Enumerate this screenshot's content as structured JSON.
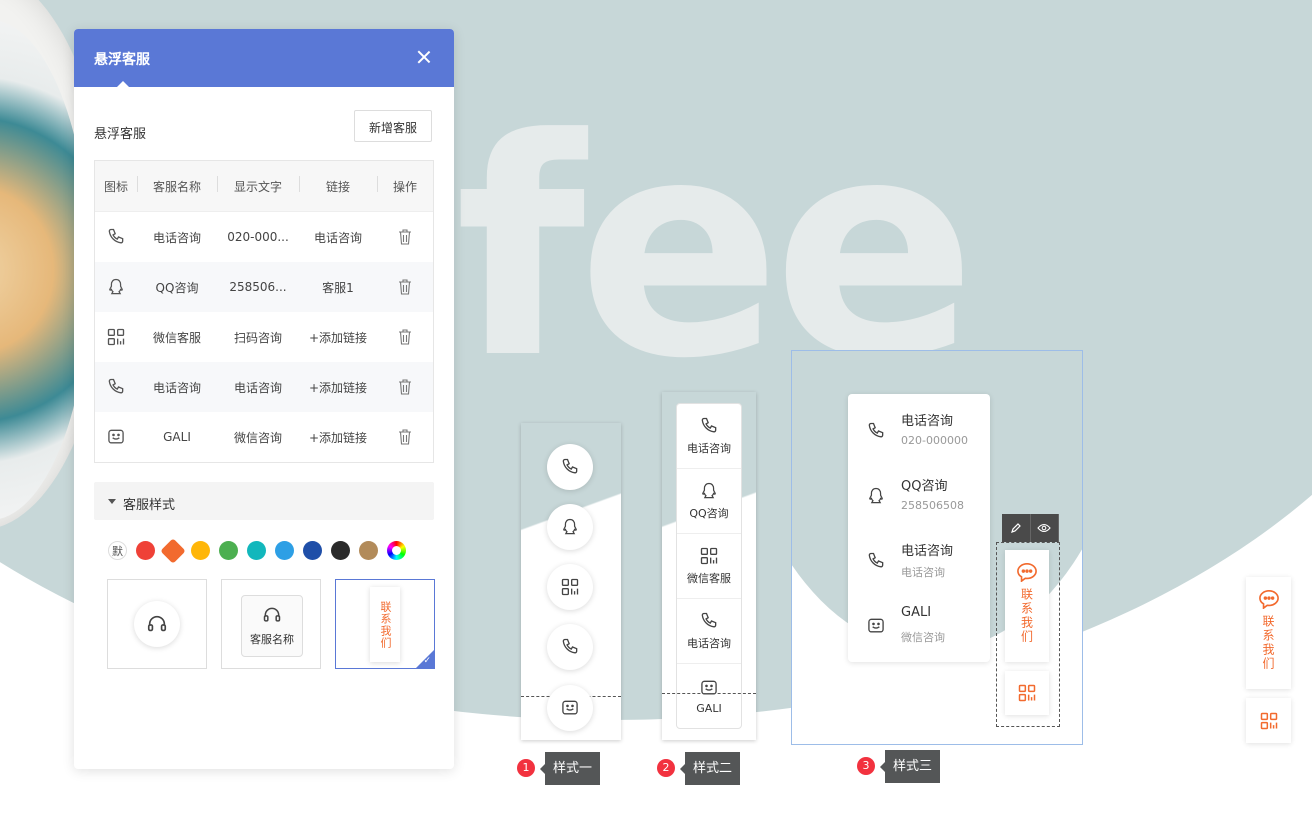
{
  "panel": {
    "title": "悬浮客服",
    "section_label": "悬浮客服",
    "add_button": "新增客服",
    "columns": [
      "图标",
      "客服名称",
      "显示文字",
      "链接",
      "操作"
    ],
    "rows": [
      {
        "icon": "phone-icon",
        "name": "电话咨询",
        "text": "020-000...",
        "link": "电话咨询"
      },
      {
        "icon": "qq-icon",
        "name": "QQ咨询",
        "text": "258506...",
        "link": "客服1"
      },
      {
        "icon": "qrcode-icon",
        "name": "微信客服",
        "text": "扫码咨询",
        "link": "+添加链接"
      },
      {
        "icon": "phone-icon",
        "name": "电话咨询",
        "text": "电话咨询",
        "link": "+添加链接"
      },
      {
        "icon": "chat-bot-icon",
        "name": "GALI",
        "text": "微信咨询",
        "link": "+添加链接"
      }
    ],
    "style_section": "客服样式",
    "default_swatch": "默",
    "colors": [
      "#ef4137",
      "#f26a2e",
      "#ffb608",
      "#4caf50",
      "#12b7bc",
      "#2d9fe5",
      "#1f4fa8",
      "#2a2a2a",
      "#b28b5a"
    ],
    "style_option2_label": "客服名称",
    "style_option3_text": "联系我们"
  },
  "preview1": {
    "label_num": "1",
    "label": "样式一"
  },
  "preview2": {
    "label_num": "2",
    "label": "样式二",
    "items": [
      "电话咨询",
      "QQ咨询",
      "微信客服",
      "电话咨询",
      "GALI"
    ]
  },
  "preview3": {
    "label_num": "3",
    "label": "样式三",
    "items": [
      {
        "title": "电话咨询",
        "sub": "020-000000"
      },
      {
        "title": "QQ咨询",
        "sub": "258506508"
      },
      {
        "title": "电话咨询",
        "sub": "电话咨询"
      },
      {
        "title": "GALI",
        "sub": "微信咨询"
      }
    ],
    "contact_text": "联系我们"
  },
  "float_right": {
    "contact_text": "联系我们"
  },
  "background_word": "fee",
  "accent_color": "#5a78d6",
  "orange": "#f26a2e"
}
